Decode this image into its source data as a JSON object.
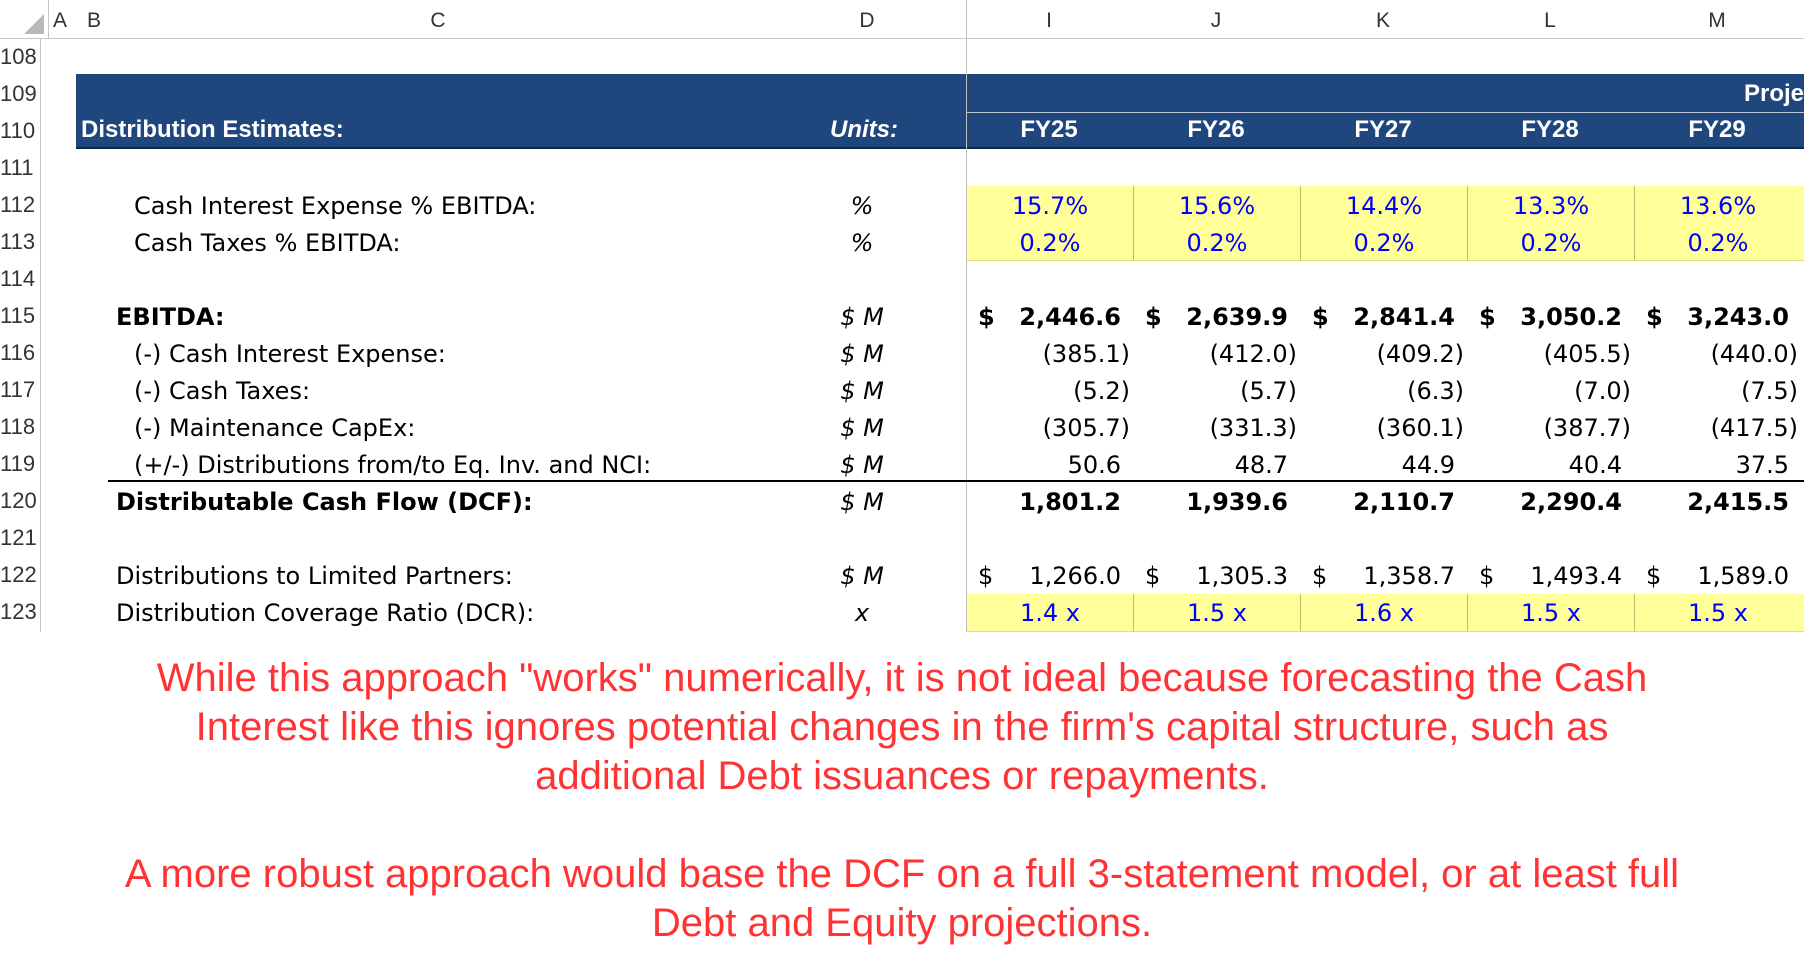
{
  "columns": [
    "A",
    "B",
    "C",
    "D",
    "I",
    "J",
    "K",
    "L",
    "M"
  ],
  "row_numbers": [
    "108",
    "109",
    "110",
    "111",
    "112",
    "113",
    "114",
    "115",
    "116",
    "117",
    "118",
    "119",
    "120",
    "121",
    "122",
    "123"
  ],
  "header": {
    "projections_label": "Proje",
    "title": "Distribution Estimates:",
    "units_label": "Units:",
    "years": [
      "FY25",
      "FY26",
      "FY27",
      "FY28",
      "FY29"
    ]
  },
  "rows": {
    "cash_interest_pct": {
      "label": "Cash Interest Expense % EBITDA:",
      "unit": "%",
      "values": [
        "15.7%",
        "15.6%",
        "14.4%",
        "13.3%",
        "13.6%"
      ]
    },
    "cash_taxes_pct": {
      "label": "Cash Taxes % EBITDA:",
      "unit": "%",
      "values": [
        "0.2%",
        "0.2%",
        "0.2%",
        "0.2%",
        "0.2%"
      ]
    },
    "ebitda": {
      "label": "EBITDA:",
      "unit": "$ M",
      "currency": "$",
      "values": [
        "2,446.6",
        "2,639.9",
        "2,841.4",
        "3,050.2",
        "3,243.0"
      ]
    },
    "cash_interest": {
      "label": "(-) Cash Interest Expense:",
      "unit": "$ M",
      "values": [
        "(385.1)",
        "(412.0)",
        "(409.2)",
        "(405.5)",
        "(440.0)"
      ]
    },
    "cash_taxes": {
      "label": "(-) Cash Taxes:",
      "unit": "$ M",
      "values": [
        "(5.2)",
        "(5.7)",
        "(6.3)",
        "(7.0)",
        "(7.5)"
      ]
    },
    "maint_capex": {
      "label": "(-) Maintenance CapEx:",
      "unit": "$ M",
      "values": [
        "(305.7)",
        "(331.3)",
        "(360.1)",
        "(387.7)",
        "(417.5)"
      ]
    },
    "distributions_eq": {
      "label": "(+/-) Distributions from/to Eq. Inv. and NCI:",
      "unit": "$ M",
      "values": [
        "50.6",
        "48.7",
        "44.9",
        "40.4",
        "37.5"
      ]
    },
    "dcf": {
      "label": "Distributable Cash Flow (DCF):",
      "unit": "$ M",
      "values": [
        "1,801.2",
        "1,939.6",
        "2,110.7",
        "2,290.4",
        "2,415.5"
      ]
    },
    "distributions_lp": {
      "label": "Distributions to Limited Partners:",
      "unit": "$ M",
      "currency": "$",
      "values": [
        "1,266.0",
        "1,305.3",
        "1,358.7",
        "1,493.4",
        "1,589.0"
      ]
    },
    "dcr": {
      "label": "Distribution Coverage Ratio (DCR):",
      "unit": "x",
      "values": [
        "1.4 x",
        "1.5 x",
        "1.6 x",
        "1.5 x",
        "1.5 x"
      ]
    }
  },
  "notes": {
    "note1_line1": "While this approach \"works\" numerically, it is not ideal because forecasting the Cash",
    "note1_line2": "Interest like this ignores potential changes in the firm's capital structure, such as",
    "note1_line3": "additional Debt issuances or repayments.",
    "note2_line1": "A more robust approach would base the DCF on a full 3-statement model, or at least full",
    "note2_line2": "Debt and Equity projections."
  },
  "colors": {
    "header_navy": "#1f477d",
    "input_yellow": "#ffff99",
    "input_blue": "#0000ff",
    "note_red": "#ff3333"
  }
}
